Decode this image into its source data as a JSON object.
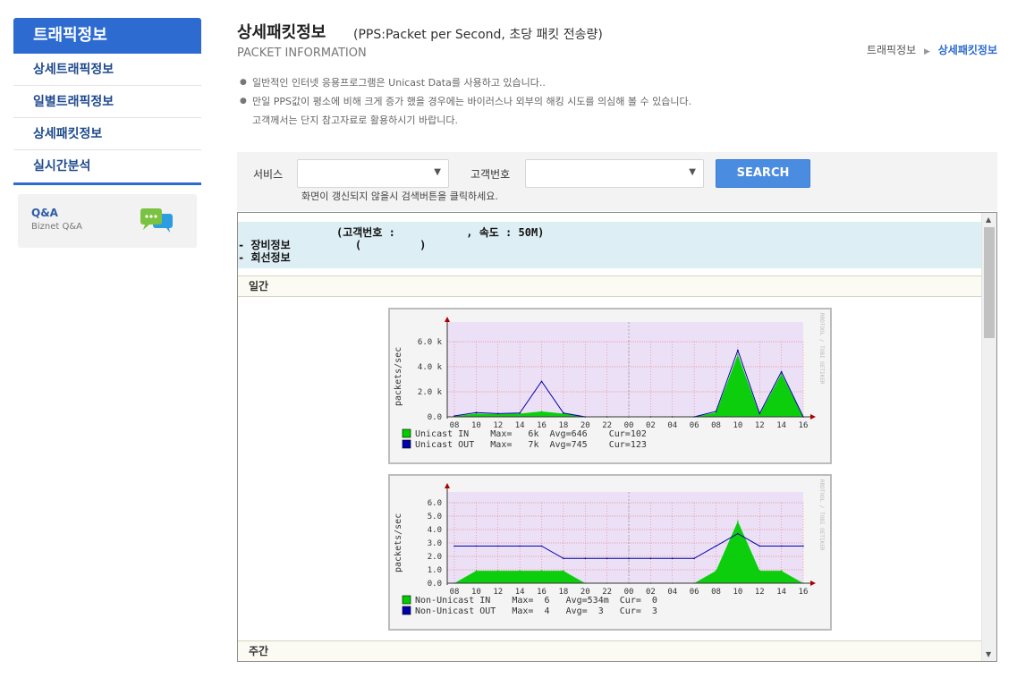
{
  "sidebar": {
    "title": "트래픽정보",
    "items": [
      {
        "label": "상세트래픽정보"
      },
      {
        "label": "일별트래픽정보"
      },
      {
        "label": "상세패킷정보"
      },
      {
        "label": "실시간분석"
      }
    ],
    "qa": {
      "title": "Q&A",
      "subtitle": "Biznet Q&A"
    }
  },
  "header": {
    "title": "상세패킷정보",
    "subtitle": "(PPS:Packet per Second, 초당 패킷 전송량)",
    "english": "PACKET INFORMATION",
    "breadcrumb": [
      "트래픽정보",
      "상세패킷정보"
    ],
    "breadcrumb_sep": "▶"
  },
  "notes": {
    "bullet": "●",
    "line1": "일반적인 인터넷 응용프로그램은 Unicast Data를 사용하고 있습니다..",
    "line2": "만일 PPS값이 평소에 비해 크게 증가 했을 경우에는 바이러스나 외부의 해킹 시도를 의심해 볼 수 있습니다.",
    "line3": "고객께서는 단지 참고자료로 활용하시기 바랍니다."
  },
  "search": {
    "service_label": "서비스",
    "service_value": "",
    "customer_label": "고객번호",
    "customer_value": "",
    "button": "SEARCH",
    "hint": "화면이 갱신되지 않을시 검색버튼을 클릭하세요.",
    "arrow": "▼"
  },
  "info": {
    "line1": "(고객번호 :           , 속도 : 50M)",
    "line2": "- 장비정보          (         )",
    "line3": "- 회선정보"
  },
  "sections": {
    "daily": "일간",
    "weekly": "주간"
  },
  "scrollbar": {
    "up": "▲",
    "down": "▼"
  },
  "graphs": [
    {
      "ylabel": "packets/sec",
      "yticks": [
        "6.0 k",
        "4.0 k",
        "2.0 k",
        "0.0"
      ],
      "xticks": [
        "08",
        "10",
        "12",
        "14",
        "16",
        "18",
        "20",
        "22",
        "00",
        "02",
        "04",
        "06",
        "08",
        "10",
        "12",
        "14",
        "16"
      ],
      "watermark": "RRDTOOL / TOBI OETIKER",
      "legend": [
        {
          "color": "#00cc00",
          "text": "Unicast IN    Max=   6k  Avg=646    Cur=102"
        },
        {
          "color": "#0000aa",
          "text": "Unicast OUT   Max=   7k  Avg=745    Cur=123"
        }
      ]
    },
    {
      "ylabel": "packets/sec",
      "yticks": [
        "6.0",
        "5.0",
        "4.0",
        "3.0",
        "2.0",
        "1.0",
        "0.0"
      ],
      "xticks": [
        "08",
        "10",
        "12",
        "14",
        "16",
        "18",
        "20",
        "22",
        "00",
        "02",
        "04",
        "06",
        "08",
        "10",
        "12",
        "14",
        "16"
      ],
      "watermark": "RRDTOOL / TOBI OETIKER",
      "legend": [
        {
          "color": "#00cc00",
          "text": "Non-Unicast IN    Max=  6   Avg=534m  Cur=  0"
        },
        {
          "color": "#0000aa",
          "text": "Non-Unicast OUT   Max=  4   Avg=  3   Cur=  3"
        }
      ]
    }
  ],
  "chart_data": [
    {
      "type": "area",
      "ylabel": "packets/sec",
      "ylim": [
        0,
        7000
      ],
      "x": [
        "08",
        "10",
        "12",
        "14",
        "16",
        "18",
        "20",
        "22",
        "00",
        "02",
        "04",
        "06",
        "08",
        "10",
        "12",
        "14",
        "16"
      ],
      "series": [
        {
          "name": "Unicast IN",
          "values": [
            50,
            300,
            250,
            300,
            500,
            300,
            0,
            0,
            0,
            0,
            0,
            0,
            400,
            5800,
            200,
            4000,
            0
          ]
        },
        {
          "name": "Unicast OUT",
          "values": [
            80,
            400,
            300,
            350,
            3300,
            350,
            0,
            0,
            0,
            0,
            0,
            0,
            500,
            6200,
            300,
            4200,
            0
          ]
        }
      ]
    },
    {
      "type": "line",
      "ylabel": "packets/sec",
      "ylim": [
        0,
        6.5
      ],
      "x": [
        "08",
        "10",
        "12",
        "14",
        "16",
        "18",
        "20",
        "22",
        "00",
        "02",
        "04",
        "06",
        "08",
        "10",
        "12",
        "14",
        "16"
      ],
      "series": [
        {
          "name": "Non-Unicast IN",
          "values": [
            0,
            1,
            1,
            1,
            1,
            1,
            0,
            0,
            0,
            0,
            0,
            0,
            1,
            5,
            1,
            1,
            0
          ]
        },
        {
          "name": "Non-Unicast OUT",
          "values": [
            3,
            3,
            3,
            3,
            3,
            2,
            2,
            2,
            2,
            2,
            2,
            2,
            3,
            4,
            3,
            3,
            3
          ]
        }
      ]
    }
  ]
}
